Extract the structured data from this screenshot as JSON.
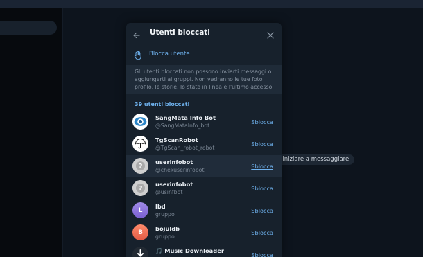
{
  "chat_hint": "er iniziare a messaggiare",
  "modal": {
    "title": "Utenti bloccati",
    "block_user_label": "Blocca utente",
    "info_text": "Gli utenti bloccati non possono inviarti messaggi o aggiungerti ai gruppi. Non vedranno le tue foto profilo, le storie, lo stato in linea e l'ultimo accesso.",
    "count_label": "39 utenti bloccati",
    "users": [
      {
        "name": "SangMata Info Bot",
        "sub": "@SangMataInfo_bot",
        "action": "Sblocca"
      },
      {
        "name": "TgScanRobot",
        "sub": "@TgScan_robot_robot",
        "action": "Sblocca"
      },
      {
        "name": "userinfobot",
        "sub": "@chekuserinfobot",
        "action": "Sblocca"
      },
      {
        "name": "userinfobot",
        "sub": "@usinfbot",
        "action": "Sblocca"
      },
      {
        "name": "lbd",
        "sub": "gruppo",
        "action": "Sblocca",
        "initial": "L"
      },
      {
        "name": "bojuldb",
        "sub": "gruppo",
        "action": "Sblocca",
        "initial": "B"
      },
      {
        "name": "🎵 Music Downloader",
        "sub": "",
        "action": "Sblocca"
      }
    ]
  },
  "colors": {
    "accent": "#6fb2ee",
    "modal_bg": "#17212c",
    "info_bg": "#1f2b38",
    "avatar_lbd": "#8a6bd9",
    "avatar_bojuldb": "#e8664f"
  },
  "icons": [
    "back-arrow-icon",
    "close-icon",
    "hand-icon",
    "eye-icon",
    "umbrella-icon",
    "question-icon",
    "download-icon"
  ]
}
